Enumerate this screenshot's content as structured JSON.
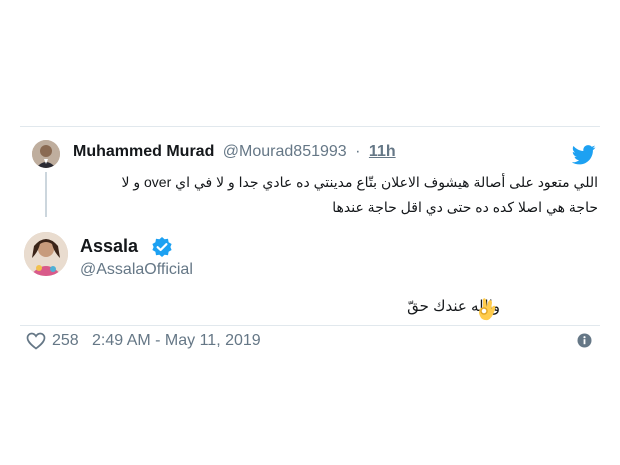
{
  "parent": {
    "name": "Muhammed Murad",
    "handle": "@Mourad851993",
    "separator": "·",
    "time": "11h",
    "text_line1": "اللي متعود على أصالة هيشوف الاعلان بتّاع مدينتي ده عادي جدا و لا في اي over و لا",
    "text_line2": "حاجة هي اصلا كده ده حتى دي اقل حاجة عندها"
  },
  "tweet": {
    "name": "Assala",
    "handle": "@AssalaOfficial",
    "text": "والله عندك حقّ",
    "likes": "258",
    "timestamp": "2:49 AM - May 11, 2019"
  },
  "icons": {
    "bird": "twitter-bird-icon",
    "verified": "verified-badge-icon",
    "ok_hand": "ok-hand-emoji",
    "heart": "heart-icon",
    "info": "info-icon"
  },
  "colors": {
    "twitter_blue": "#1da1f2",
    "text_primary": "#14171a",
    "text_secondary": "#657786",
    "divider": "#e1e8ed",
    "emoji_yellow": "#ffcc4d"
  }
}
